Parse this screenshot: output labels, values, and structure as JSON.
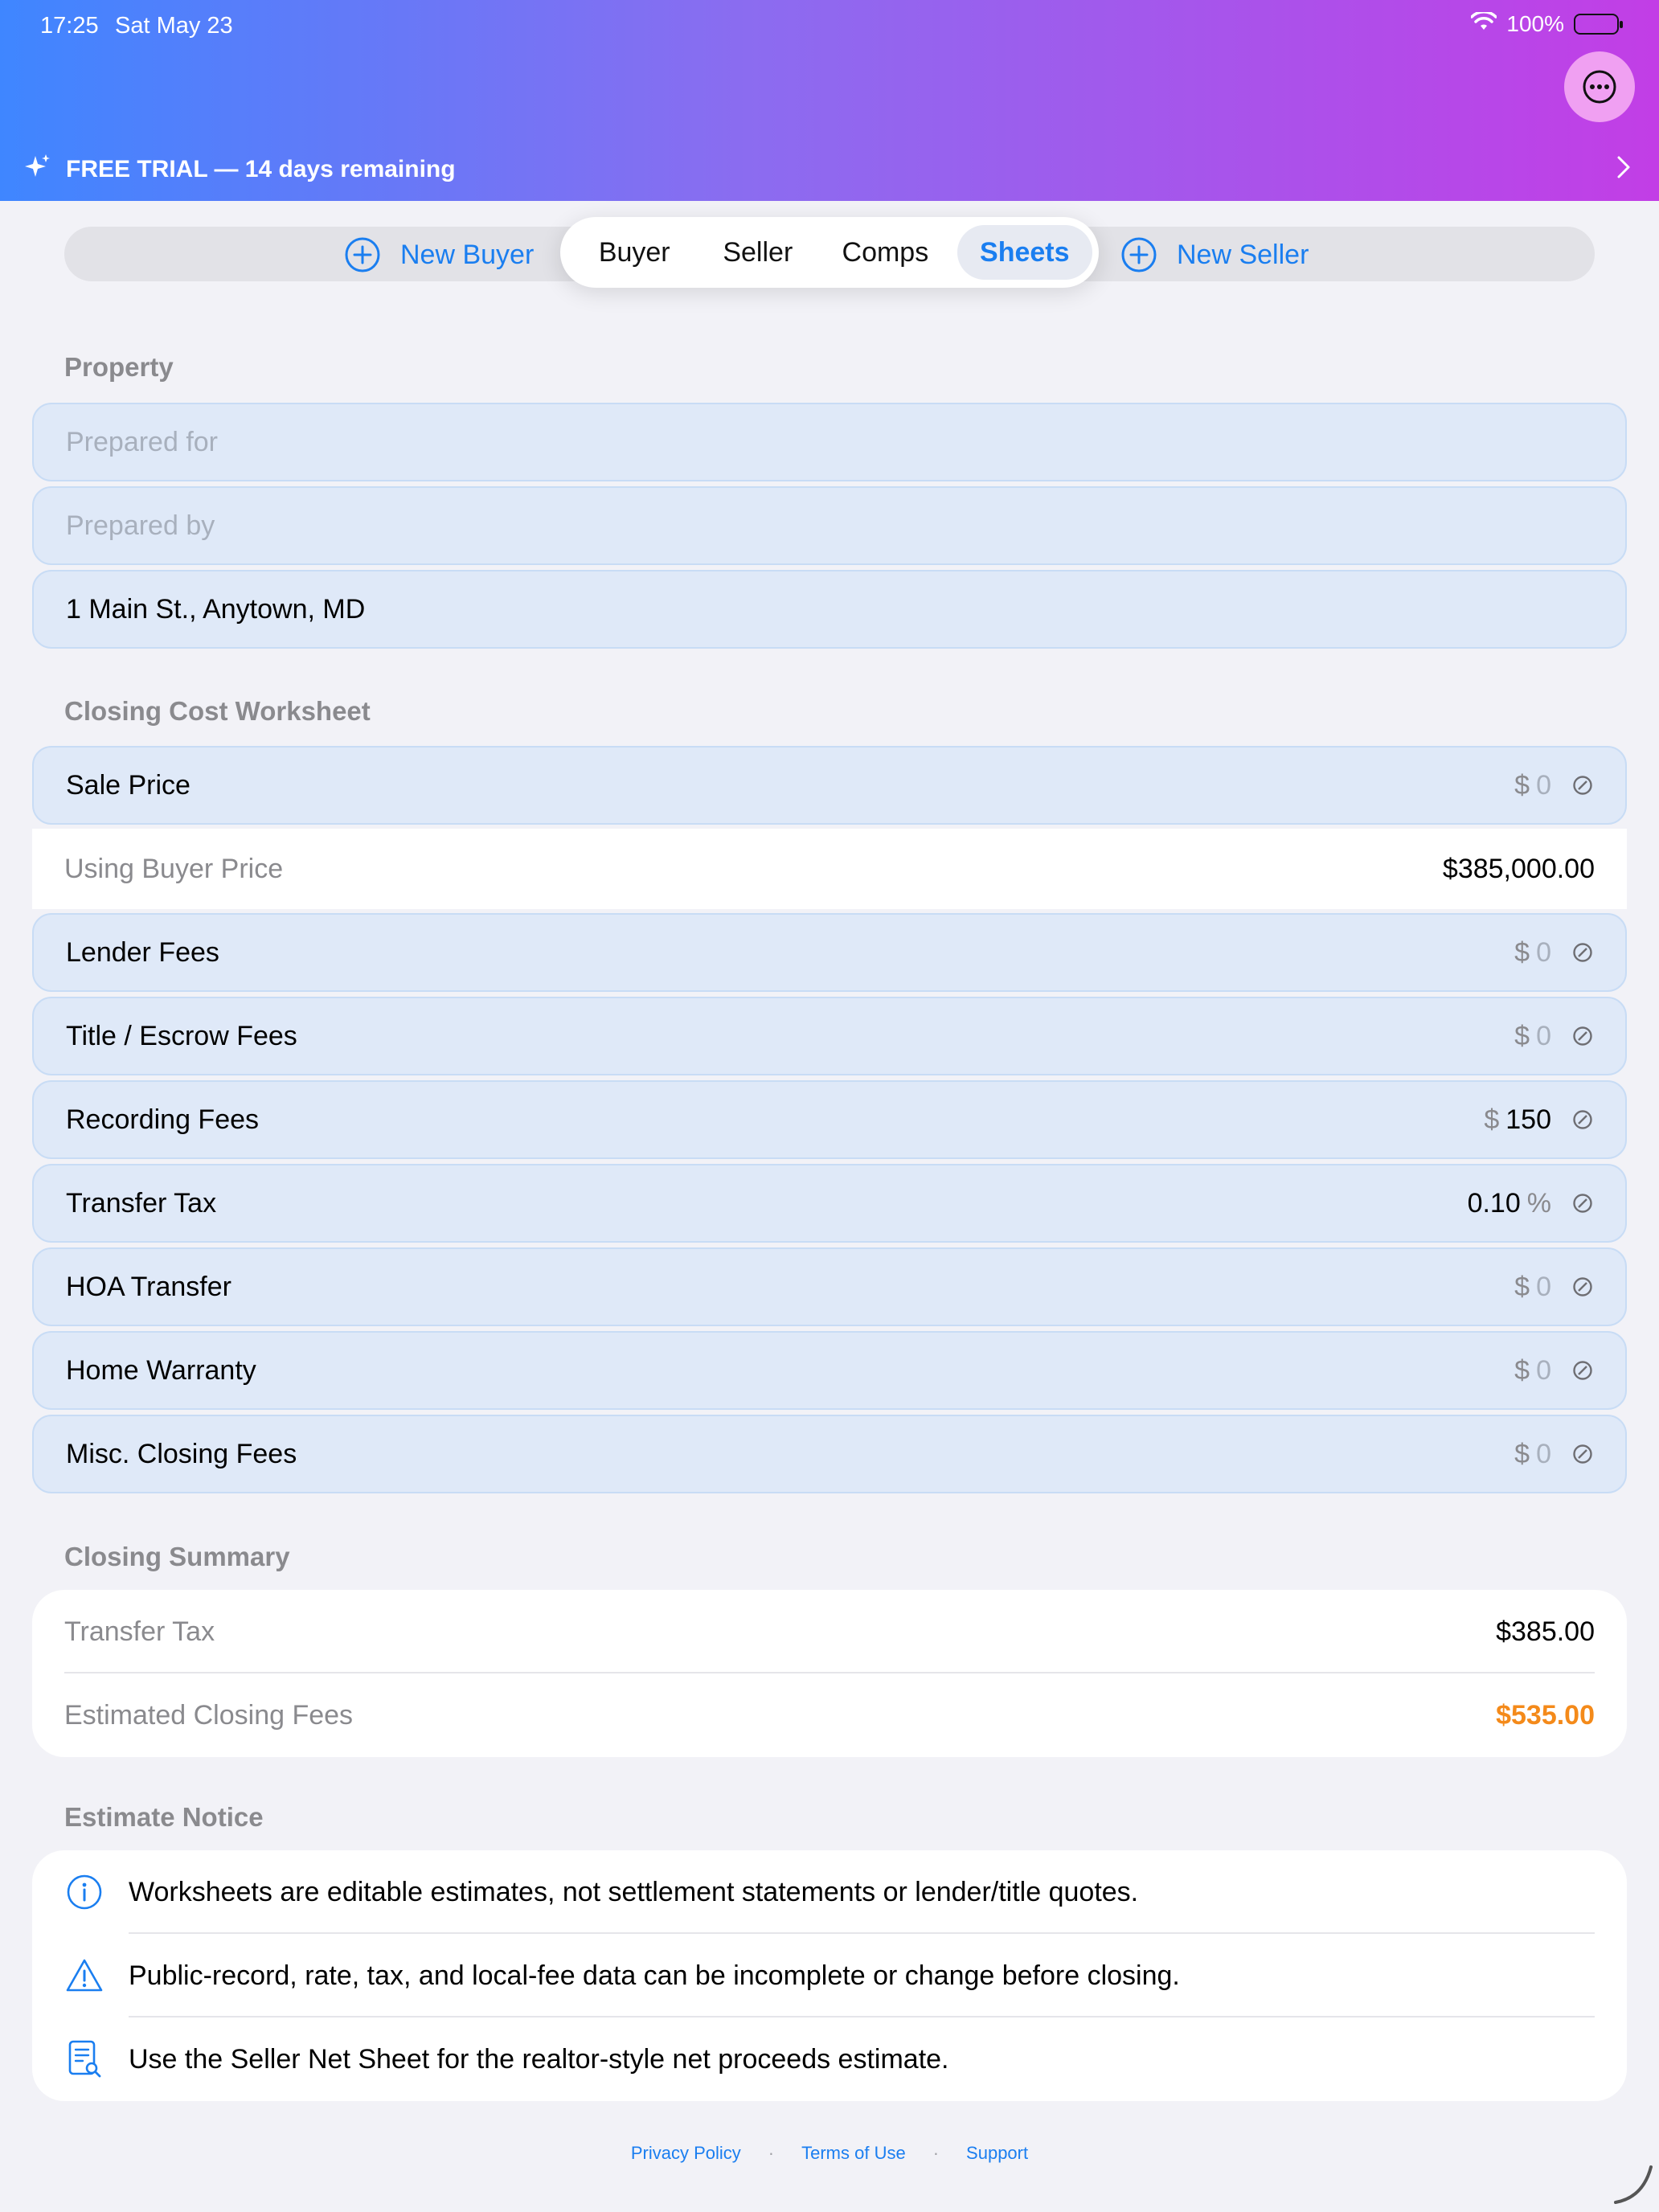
{
  "status_bar": {
    "time": "17:25",
    "date": "Sat May 23",
    "battery": "100%"
  },
  "header": {
    "trial_text": "FREE TRIAL — 14 days remaining",
    "accent_start": "#3f86ff",
    "accent_end": "#c23ee6"
  },
  "segmented": {
    "new_buyer": "New Buyer",
    "new_seller": "New Seller",
    "tabs": [
      {
        "label": "Buyer",
        "active": false
      },
      {
        "label": "Seller",
        "active": false
      },
      {
        "label": "Comps",
        "active": false
      },
      {
        "label": "Sheets",
        "active": true
      }
    ]
  },
  "property": {
    "title": "Property",
    "prepared_for_placeholder": "Prepared for",
    "prepared_by_placeholder": "Prepared by",
    "address": "1 Main St., Anytown, MD"
  },
  "worksheet": {
    "title": "Closing Cost Worksheet",
    "sale_price": {
      "label": "Sale Price",
      "unit": "$",
      "value": "0"
    },
    "using_buyer_price": {
      "label": "Using Buyer Price",
      "value": "$385,000.00"
    },
    "lender_fees": {
      "label": "Lender Fees",
      "unit": "$",
      "value": "0"
    },
    "title_escrow": {
      "label": "Title / Escrow Fees",
      "unit": "$",
      "value": "0"
    },
    "recording_fees": {
      "label": "Recording Fees",
      "unit": "$",
      "value": "150"
    },
    "transfer_tax": {
      "label": "Transfer Tax",
      "unit": "%",
      "value": "0.10"
    },
    "hoa_transfer": {
      "label": "HOA Transfer",
      "unit": "$",
      "value": "0"
    },
    "home_warranty": {
      "label": "Home Warranty",
      "unit": "$",
      "value": "0"
    },
    "misc_closing": {
      "label": "Misc. Closing Fees",
      "unit": "$",
      "value": "0"
    }
  },
  "summary": {
    "title": "Closing Summary",
    "transfer_tax": {
      "label": "Transfer Tax",
      "value": "$385.00"
    },
    "estimated": {
      "label": "Estimated Closing Fees",
      "value": "$535.00",
      "color": "#f48a1a"
    }
  },
  "notice": {
    "title": "Estimate Notice",
    "items": [
      {
        "icon": "info-icon",
        "text": "Worksheets are editable estimates, not settlement statements or lender/title quotes."
      },
      {
        "icon": "warning-icon",
        "text": "Public-record, rate, tax, and local-fee data can be incomplete or change before closing."
      },
      {
        "icon": "document-search-icon",
        "text": "Use the Seller Net Sheet for the realtor-style net proceeds estimate."
      }
    ]
  },
  "footer": {
    "privacy": "Privacy Policy",
    "terms": "Terms of Use",
    "support": "Support",
    "separator": "·"
  }
}
